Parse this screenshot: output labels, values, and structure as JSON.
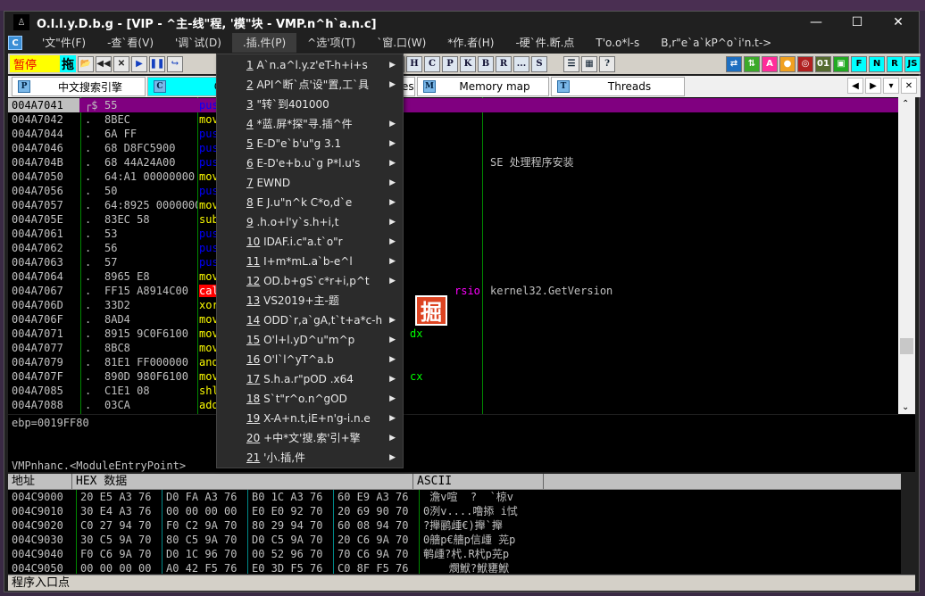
{
  "window": {
    "title": "O.l.l.y.D.b.g - [VIP -  ^主-线\"程, '模\"块 - VMP.n^h`a.n.c]",
    "controls": [
      "—",
      "☐",
      "✕"
    ]
  },
  "menubar": {
    "icon": "C",
    "items": [
      "'文\"件(F)",
      "-查`看(V)",
      "'调`试(D)",
      ".插.件(P)",
      "^选'项(T)",
      "`窗.口(W)",
      "*作.者(H)",
      "-硬`件.断.点",
      "T'o.o*l-s",
      "B,r\"e`a`kP^o`i'n.t->"
    ],
    "active": 3
  },
  "toolbar": {
    "status": "暂停",
    "drag": "拖",
    "buttons_left": [
      "📂",
      "◀◀",
      "✕",
      "▶",
      "❚❚",
      "↪"
    ],
    "letters": [
      "T",
      "W",
      "H",
      "C",
      "P",
      "K",
      "B",
      "R",
      "...",
      "S"
    ],
    "misc": [
      "☰",
      "▦",
      "?"
    ],
    "right": [
      {
        "label": "⇄",
        "color": "#1e6fc0"
      },
      {
        "label": "⇅",
        "color": "#3caa2a"
      },
      {
        "label": "A",
        "color": "#ff2d9a"
      },
      {
        "label": "●",
        "color": "#f0a020"
      },
      {
        "label": "◎",
        "color": "#b02020"
      },
      {
        "label": "01",
        "color": "#556b2f"
      },
      {
        "label": "▣",
        "color": "#22aa22"
      },
      {
        "label": "F",
        "color": "#00ffff"
      },
      {
        "label": "N",
        "color": "#00ffff"
      },
      {
        "label": "R",
        "color": "#00ffff"
      },
      {
        "label": "JS",
        "color": "#00ffff"
      }
    ]
  },
  "tabs": [
    {
      "icon": "P",
      "label": "中文搜索引擎"
    },
    {
      "icon": "C",
      "label": "CPU"
    },
    {
      "icon": "E",
      "label": "Executable modules"
    },
    {
      "icon": "M",
      "label": "Memory map"
    },
    {
      "icon": "T",
      "label": "Threads"
    }
  ],
  "tabnav": [
    "◀",
    "▶",
    "▾",
    "✕"
  ],
  "disasm": [
    {
      "addr": "004A7041",
      "mark": "┌$",
      "hex": "55",
      "mn": "push",
      "cls": "push",
      "cmt": ""
    },
    {
      "addr": "004A7042",
      "mark": ".",
      "hex": "8BEC",
      "mn": "mov",
      "cls": "mov",
      "cmt": ""
    },
    {
      "addr": "004A7044",
      "mark": ".",
      "hex": "6A FF",
      "mn": "push",
      "cls": "push",
      "cmt": ""
    },
    {
      "addr": "004A7046",
      "mark": ".",
      "hex": "68 D8FC5900",
      "mn": "push",
      "cls": "push",
      "cmt": ""
    },
    {
      "addr": "004A704B",
      "mark": ".",
      "hex": "68 44A24A00",
      "mn": "push",
      "cls": "push",
      "cmt": "SE 处理程序安装"
    },
    {
      "addr": "004A7050",
      "mark": ".",
      "hex": "64:A1 00000000",
      "mn": "mov",
      "cls": "mov",
      "cmt": ""
    },
    {
      "addr": "004A7056",
      "mark": ".",
      "hex": "50",
      "mn": "push",
      "cls": "push",
      "cmt": ""
    },
    {
      "addr": "004A7057",
      "mark": ".",
      "hex": "64:8925 00000000",
      "mn": "mov",
      "cls": "mov",
      "cmt": ""
    },
    {
      "addr": "004A705E",
      "mark": ".",
      "hex": "83EC 58",
      "mn": "sub",
      "cls": "mov",
      "cmt": ""
    },
    {
      "addr": "004A7061",
      "mark": ".",
      "hex": "53",
      "mn": "push",
      "cls": "push",
      "cmt": ""
    },
    {
      "addr": "004A7062",
      "mark": ".",
      "hex": "56",
      "mn": "push",
      "cls": "push",
      "cmt": ""
    },
    {
      "addr": "004A7063",
      "mark": ".",
      "hex": "57",
      "mn": "push",
      "cls": "push",
      "cmt": ""
    },
    {
      "addr": "004A7064",
      "mark": ".",
      "hex": "8965 E8",
      "mn": "mov",
      "cls": "mov",
      "cmt": ""
    },
    {
      "addr": "004A7067",
      "mark": ".",
      "hex": "FF15 A8914C00",
      "mn": "call",
      "cls": "call",
      "op": "rsio",
      "cmt": "kernel32.GetVersion"
    },
    {
      "addr": "004A706D",
      "mark": ".",
      "hex": "33D2",
      "mn": "xor",
      "cls": "mov",
      "cmt": ""
    },
    {
      "addr": "004A706F",
      "mark": ".",
      "hex": "8AD4",
      "mn": "mov",
      "cls": "mov",
      "cmt": ""
    },
    {
      "addr": "004A7071",
      "mark": ".",
      "hex": "8915 9C0F6100",
      "mn": "mov",
      "cls": "mov",
      "op": "dx",
      "cmt": ""
    },
    {
      "addr": "004A7077",
      "mark": ".",
      "hex": "8BC8",
      "mn": "mov",
      "cls": "mov",
      "cmt": ""
    },
    {
      "addr": "004A7079",
      "mark": ".",
      "hex": "81E1 FF000000",
      "mn": "and",
      "cls": "mov",
      "cmt": ""
    },
    {
      "addr": "004A707F",
      "mark": ".",
      "hex": "890D 980F6100",
      "mn": "mov",
      "cls": "mov",
      "op": "cx",
      "cmt": ""
    },
    {
      "addr": "004A7085",
      "mark": ".",
      "hex": "C1E1 08",
      "mn": "shl",
      "cls": "mov",
      "cmt": ""
    },
    {
      "addr": "004A7088",
      "mark": ".",
      "hex": "03CA",
      "mn": "add",
      "cls": "mov",
      "cmt": ""
    }
  ],
  "info": {
    "line1": "ebp=0019FF80",
    "line2": "VMPnhanc.<ModuleEntryPoint>"
  },
  "dump": {
    "headers": [
      "地址",
      "HEX 数据",
      "ASCII"
    ],
    "rows": [
      {
        "addr": "004C9000",
        "hex": [
          "20 E5 A3 76",
          "D0 FA A3 76",
          "B0 1C A3 76",
          "60 E9 A3 76"
        ],
        "ascii": " 澹v喧  ?  `椋v"
      },
      {
        "addr": "004C9010",
        "hex": [
          "30 E4 A3 76",
          "00 00 00 00",
          "E0 E0 92 70",
          "20 69 90 70"
        ],
        "ascii": "0洌v....噜掭 i恜"
      },
      {
        "addr": "004C9020",
        "hex": [
          "C0 27 94 70",
          "F0 C2 9A 70",
          "80 29 94 70",
          "60 08 94 70"
        ],
        "ascii": "?攑鹂歱€)攑`攑"
      },
      {
        "addr": "004C9030",
        "hex": [
          "30 C5 9A 70",
          "80 C5 9A 70",
          "D0 C5 9A 70",
          "20 C6 9A 70"
        ],
        "ascii": "0艢p€艢p信歱 茪p"
      },
      {
        "addr": "004C9040",
        "hex": [
          "F0 C6 9A 70",
          "D0 1C 96 70",
          "00 52 96 70",
          "70 C6 9A 70"
        ],
        "ascii": "鹌歱?杙.R杙p茪p"
      },
      {
        "addr": "004C9050",
        "hex": [
          "00 00 00 00",
          "A0 42 F5 76",
          "E0 3D F5 76",
          "C0 8F F5 76"
        ],
        "ascii": "    燘鮲?鮲罋鮲"
      }
    ]
  },
  "status": "程序入口点",
  "plugin_menu": [
    {
      "n": "1",
      "label": "A`n.a^l.y.z'eT-h+i+s",
      "sub": true
    },
    {
      "n": "2",
      "label": "API^断`点'设\"置,工`具",
      "sub": true
    },
    {
      "n": "3",
      "label": "\"转`到401000",
      "sub": false
    },
    {
      "n": "4",
      "label": "*蓝.屏*探\"寻.插^件",
      "sub": true
    },
    {
      "n": "5",
      "label": "E-D\"e`b'u\"g 3.1",
      "sub": true
    },
    {
      "n": "6",
      "label": "E-D'e+b.u`g P*l.u's",
      "sub": true
    },
    {
      "n": "7",
      "label": "EWND",
      "sub": true
    },
    {
      "n": "8",
      "label": "E J.u\"n^k C*o,d`e",
      "sub": true
    },
    {
      "n": "9",
      "label": ".h.o+l'y`s.h+i,t",
      "sub": true
    },
    {
      "n": "10",
      "label": "IDAF.i.c\"a.t`o\"r",
      "sub": true
    },
    {
      "n": "11",
      "label": "I+m*mL.a`b-e^l",
      "sub": true
    },
    {
      "n": "12",
      "label": "OD.b+gS`c*r+i,p^t",
      "sub": true
    },
    {
      "n": "13",
      "label": "VS2019+主-题",
      "sub": false
    },
    {
      "n": "14",
      "label": "ODD`r,a`gA,t`t+a*c-h",
      "sub": true
    },
    {
      "n": "15",
      "label": "O'l+l.yD^u\"m^p",
      "sub": true
    },
    {
      "n": "16",
      "label": "O'l`l^yT^a.b",
      "sub": true
    },
    {
      "n": "17",
      "label": "S.h.a.r\"pOD .x64",
      "sub": true
    },
    {
      "n": "18",
      "label": "S`t\"r^o.n^gOD",
      "sub": true
    },
    {
      "n": "19",
      "label": "X-A+n.t,iE+n'g-i.n.e",
      "sub": true
    },
    {
      "n": "20",
      "label": "+中*文'搜.索'引+擎",
      "sub": true
    },
    {
      "n": "21",
      "label": "'小.插,件",
      "sub": true
    }
  ],
  "colors": {
    "push": "#0000ff",
    "mov": "#ffff00",
    "call_bg": "#ff0000",
    "selected_row": "#800080",
    "operand_green": "#00ff00",
    "operand_magenta": "#ff00ff"
  }
}
